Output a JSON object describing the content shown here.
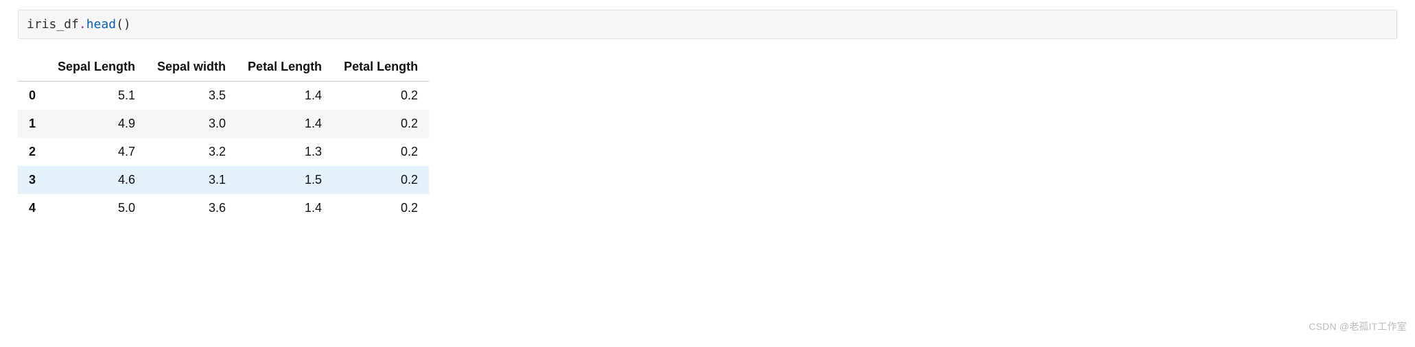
{
  "code_cell": {
    "ident": "iris_df",
    "dot": ".",
    "method": "head",
    "open_paren": "(",
    "close_paren": ")"
  },
  "chart_data": {
    "type": "table",
    "title": "",
    "headers": [
      "Sepal Length",
      "Sepal width",
      "Petal Length",
      "Petal Length"
    ],
    "index": [
      "0",
      "1",
      "2",
      "3",
      "4"
    ],
    "rows": [
      [
        5.1,
        3.5,
        1.4,
        0.2
      ],
      [
        4.9,
        3.0,
        1.4,
        0.2
      ],
      [
        4.7,
        3.2,
        1.3,
        0.2
      ],
      [
        4.6,
        3.1,
        1.5,
        0.2
      ],
      [
        5.0,
        3.6,
        1.4,
        0.2
      ]
    ],
    "highlight_index": 3
  },
  "watermark": "CSDN @老孤IT工作室"
}
